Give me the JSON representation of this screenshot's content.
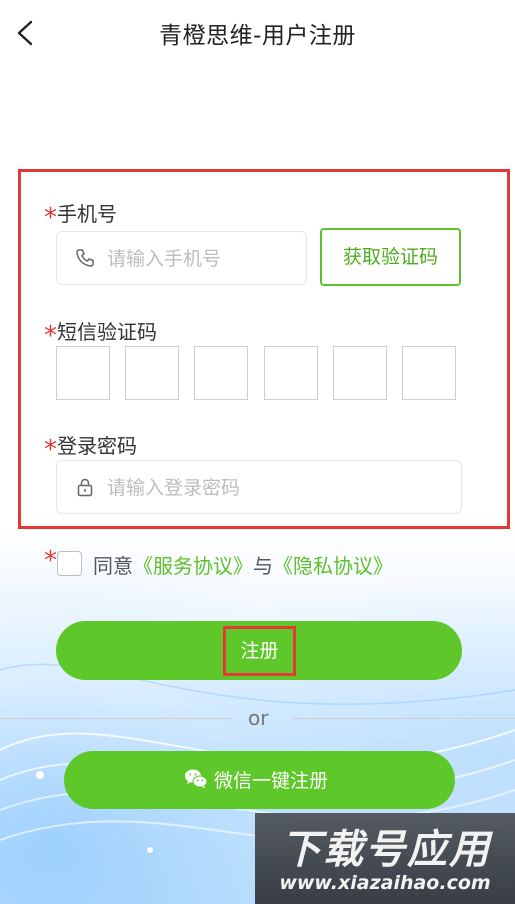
{
  "header": {
    "title": "青橙思维-用户注册"
  },
  "form": {
    "required_mark": "*",
    "phone": {
      "label": "手机号",
      "placeholder": "请输入手机号",
      "value": ""
    },
    "get_code_button": "获取验证码",
    "sms_code": {
      "label": "短信验证码",
      "digits": [
        "",
        "",
        "",
        "",
        "",
        ""
      ]
    },
    "password": {
      "label": "登录密码",
      "placeholder": "请输入登录密码",
      "value": ""
    }
  },
  "agreement": {
    "prefix": "同意",
    "service_link": "《服务协议》",
    "conj": "与",
    "privacy_link": "《隐私协议》",
    "checked": false
  },
  "register_button": "注册",
  "divider_text": "or",
  "wechat_button": "微信一键注册",
  "watermark": {
    "title": "下载号应用",
    "url": "www.xiazaihao.com"
  },
  "colors": {
    "accent_green": "#5ec72a",
    "highlight_red": "#e53935"
  }
}
